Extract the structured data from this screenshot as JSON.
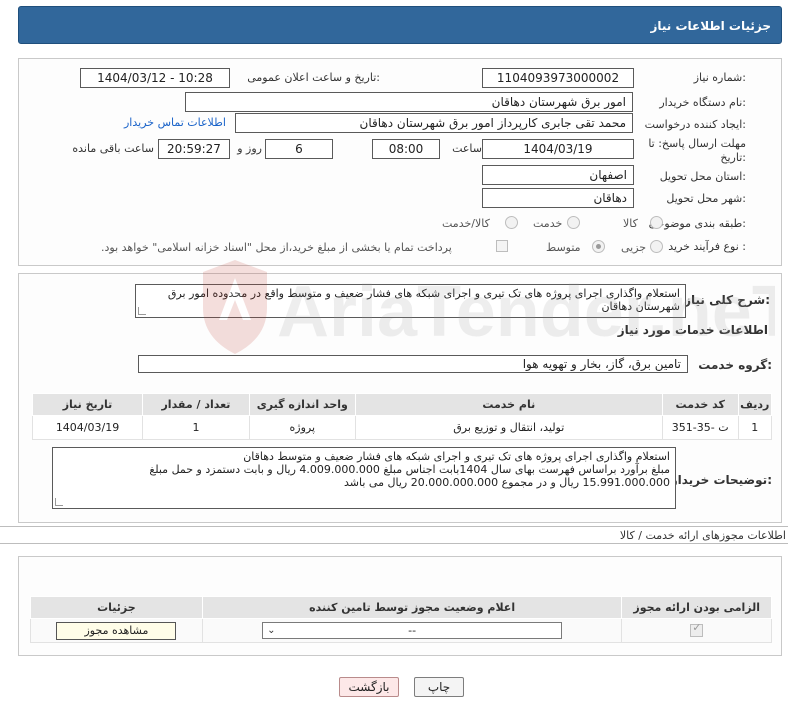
{
  "header": {
    "title": "جزئیات اطلاعات نیاز"
  },
  "form": {
    "need_number_label": "شماره نیاز:",
    "need_number": "1104093973000002",
    "announce_label": "تاریخ و ساعت اعلان عمومی:",
    "announce_value": "1404/03/12 - 10:28",
    "buyer_org_label": "نام دستگاه خریدار:",
    "buyer_org": "امور برق شهرستان دهاقان",
    "requester_label": "ایجاد کننده درخواست:",
    "requester": "محمد تقی جابری کارپرداز امور برق شهرستان دهاقان",
    "contact_link": "اطلاعات تماس خریدار",
    "deadline_label_1": "مهلت ارسال پاسخ: تا",
    "deadline_label_2": "تاریخ:",
    "deadline_date": "1404/03/19",
    "time_label": "ساعت",
    "deadline_time": "08:00",
    "days_value": "6",
    "days_label": "روز و",
    "remaining_time": "20:59:27",
    "remaining_label": "ساعت باقی مانده",
    "province_label": "استان محل تحویل:",
    "province": "اصفهان",
    "city_label": "شهر محل تحویل:",
    "city": "دهاقان",
    "category_label": "طبقه بندی موضوعی:",
    "category_options": [
      "کالا",
      "خدمت",
      "کالا/خدمت"
    ],
    "process_label": "نوع فرآیند خرید :",
    "process_options": [
      "جزیی",
      "متوسط"
    ],
    "treasury_note": "پرداخت تمام یا بخشی از مبلغ خرید،از محل \"اسناد خزانه اسلامی\" خواهد بود."
  },
  "summary": {
    "label": "شرح کلی نیاز:",
    "text": "استعلام واگذاری اجرای پروژه های تک تیری و اجرای شبکه های فشار ضعیف و متوسط  واقع در محدوده امور برق شهرستان دهاقان"
  },
  "services": {
    "section_title": "اطلاعات خدمات مورد نیاز",
    "group_label": "گروه خدمت:",
    "group_value": "تامین برق، گاز، بخار و تهویه هوا",
    "columns": [
      "ردیف",
      "کد خدمت",
      "نام خدمت",
      "واحد اندازه گیری",
      "تعداد / مقدار",
      "تاریخ نیاز"
    ],
    "rows": [
      [
        "1",
        "ت -35-351",
        "تولید، انتقال و توزیع برق",
        "پروژه",
        "1",
        "1404/03/19"
      ]
    ]
  },
  "buyer_notes": {
    "label": "توضیحات خریدار:",
    "lines": [
      "استعلام واگذاری اجرای پروژه های تک تیری و اجرای شبکه های فشار ضعیف و متوسط  دهاقان",
      "مبلغ برآورد براساس فهرست بهای سال 1404بابت اجناس مبلغ 4.009.000.000 ریال و بابت دستمزد و حمل مبلغ",
      "15.991.000.000 ریال و در مجموع 20.000.000.000 ریال می باشد"
    ]
  },
  "permits": {
    "section_title": "اطلاعات مجوزهای ارائه خدمت / کالا",
    "columns": [
      "الزامی بودن ارائه مجوز",
      "اعلام وضعیت مجوز توسط تامین کننده",
      "جزئیات"
    ],
    "select_value": "--",
    "view_button": "مشاهده مجوز"
  },
  "footer": {
    "print_button": "چاپ",
    "back_button": "بازگشت"
  },
  "watermark": {
    "text": "AriaTender.neT"
  }
}
